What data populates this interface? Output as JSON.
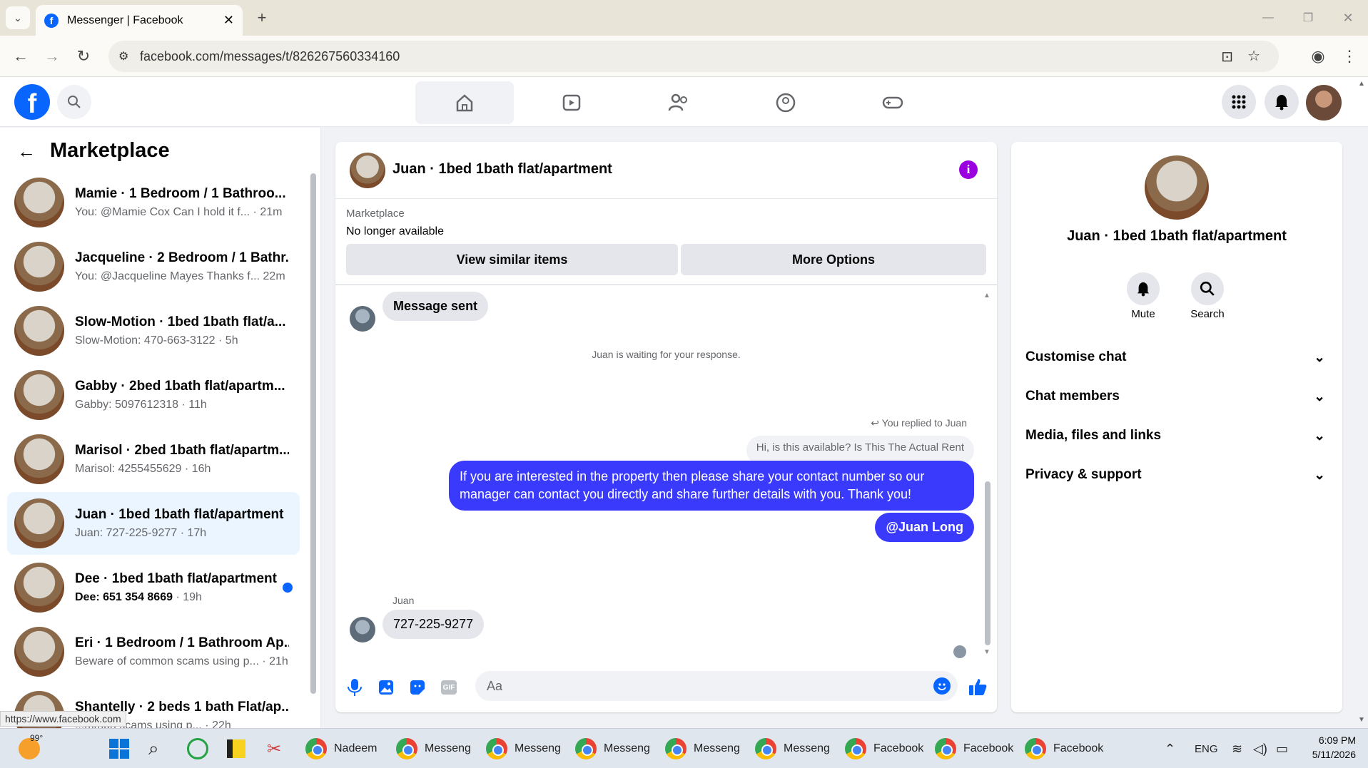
{
  "browser": {
    "tab_title": "Messenger | Facebook",
    "url": "facebook.com/messages/t/826267560334160",
    "status_url": "https://www.facebook.com"
  },
  "sidebar": {
    "title": "Marketplace",
    "conversations": [
      {
        "name": "Mamie · 1 Bedroom / 1 Bathroo...",
        "preview": "You: @Mamie Cox Can I hold it f...",
        "time": "· 21m"
      },
      {
        "name": "Jacqueline · 2 Bedroom / 1 Bathr...",
        "preview": "You: @Jacqueline Mayes Thanks f...",
        "time": "22m"
      },
      {
        "name": "Slow-Motion · 1bed 1bath flat/a...",
        "preview": "Slow-Motion: 470-663-3122",
        "time": "· 5h"
      },
      {
        "name": "Gabby · 2bed 1bath flat/apartm...",
        "preview": "Gabby: 5097612318",
        "time": "· 11h"
      },
      {
        "name": "Marisol · 2bed 1bath flat/apartm...",
        "preview": "Marisol: 4255455629",
        "time": "· 16h"
      },
      {
        "name": "Juan · 1bed 1bath flat/apartment",
        "preview": "Juan: 727-225-9277",
        "time": "· 17h"
      },
      {
        "name": "Dee · 1bed 1bath flat/apartment",
        "preview": "Dee: 651 354 8669",
        "time": "· 19h"
      },
      {
        "name": "Eri · 1 Bedroom / 1 Bathroom Ap...",
        "preview": "Beware of common scams using p...",
        "time": "· 21h"
      },
      {
        "name": "Shantelly · 2 beds 1 bath Flat/ap...",
        "preview": "...mmon scams using p...",
        "time": "· 22h"
      }
    ]
  },
  "chat": {
    "title": "Juan · 1bed 1bath flat/apartment",
    "banner_label": "Marketplace",
    "banner_status": "No longer available",
    "btn_similar": "View similar items",
    "btn_more": "More Options",
    "msg_sent": "Message sent",
    "waiting": "Juan is waiting for your response.",
    "replied_to": "You replied to Juan",
    "quoted": "Hi, is this available? Is This The Actual Rent",
    "outgoing": "If you are interested in the property then please share your contact number so our manager can contact you directly and share further details with you. Thank you!",
    "mention": "@Juan Long",
    "sender": "Juan",
    "incoming": "727-225-9277",
    "input_placeholder": "Aa"
  },
  "details": {
    "title": "Juan · 1bed 1bath flat/apartment",
    "mute": "Mute",
    "search": "Search",
    "sections": [
      "Customise chat",
      "Chat members",
      "Media, files and links",
      "Privacy & support"
    ]
  },
  "taskbar": {
    "weather": "99°",
    "apps": [
      "Nadeem",
      "Messeng",
      "Messeng",
      "Messeng",
      "Messeng",
      "Messeng",
      "Facebook",
      "Facebook",
      "Facebook"
    ],
    "lang": "ENG",
    "time": "6:09 PM",
    "date": "5/11/2026"
  },
  "colors": {
    "fb_blue": "#0866ff",
    "bubble_blue": "#3a3afd",
    "accent_purple": "#9b00e0"
  }
}
